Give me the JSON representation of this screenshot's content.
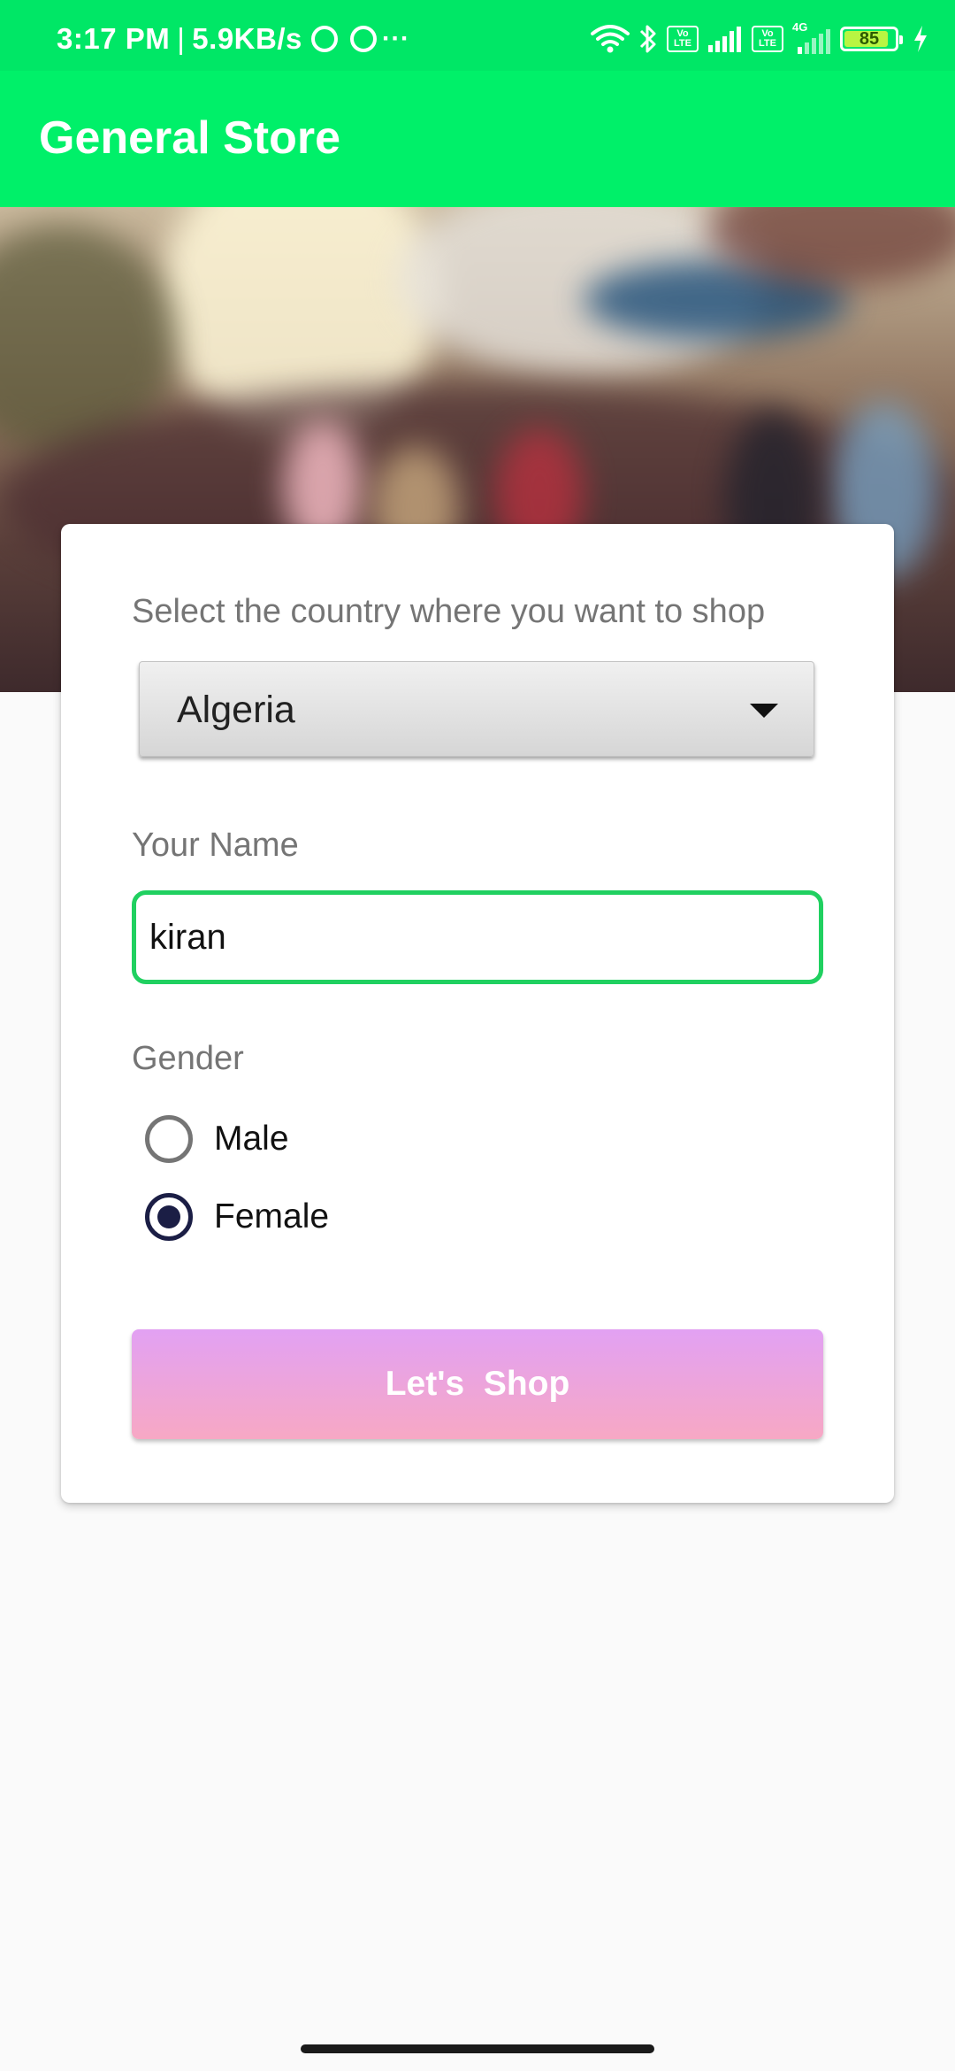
{
  "status_bar": {
    "time": "3:17 PM",
    "speed": "5.9KB/s",
    "separator": "|",
    "dots": "···",
    "network_4g": "4G",
    "volte_1": "Vo LTE",
    "volte_2": "Vo LTE",
    "battery_percent": "85",
    "battery_level": 0.85
  },
  "app_bar": {
    "title": "General Store"
  },
  "form": {
    "country_label": "Select the country where you want to shop",
    "country_selected": "Algeria",
    "name_label": "Your Name",
    "name_value": "kiran",
    "gender_label": "Gender",
    "gender_options": [
      {
        "label": "Male",
        "checked": false
      },
      {
        "label": "Female",
        "checked": true
      }
    ],
    "submit_label": "Let's  Shop"
  },
  "colors": {
    "app_bar": "#00f069",
    "status_bar": "#00e766",
    "input_border": "#20d060",
    "radio_checked": "#1b1e45",
    "button_top": "#e2a1f3",
    "button_bottom": "#f7a8c4"
  }
}
